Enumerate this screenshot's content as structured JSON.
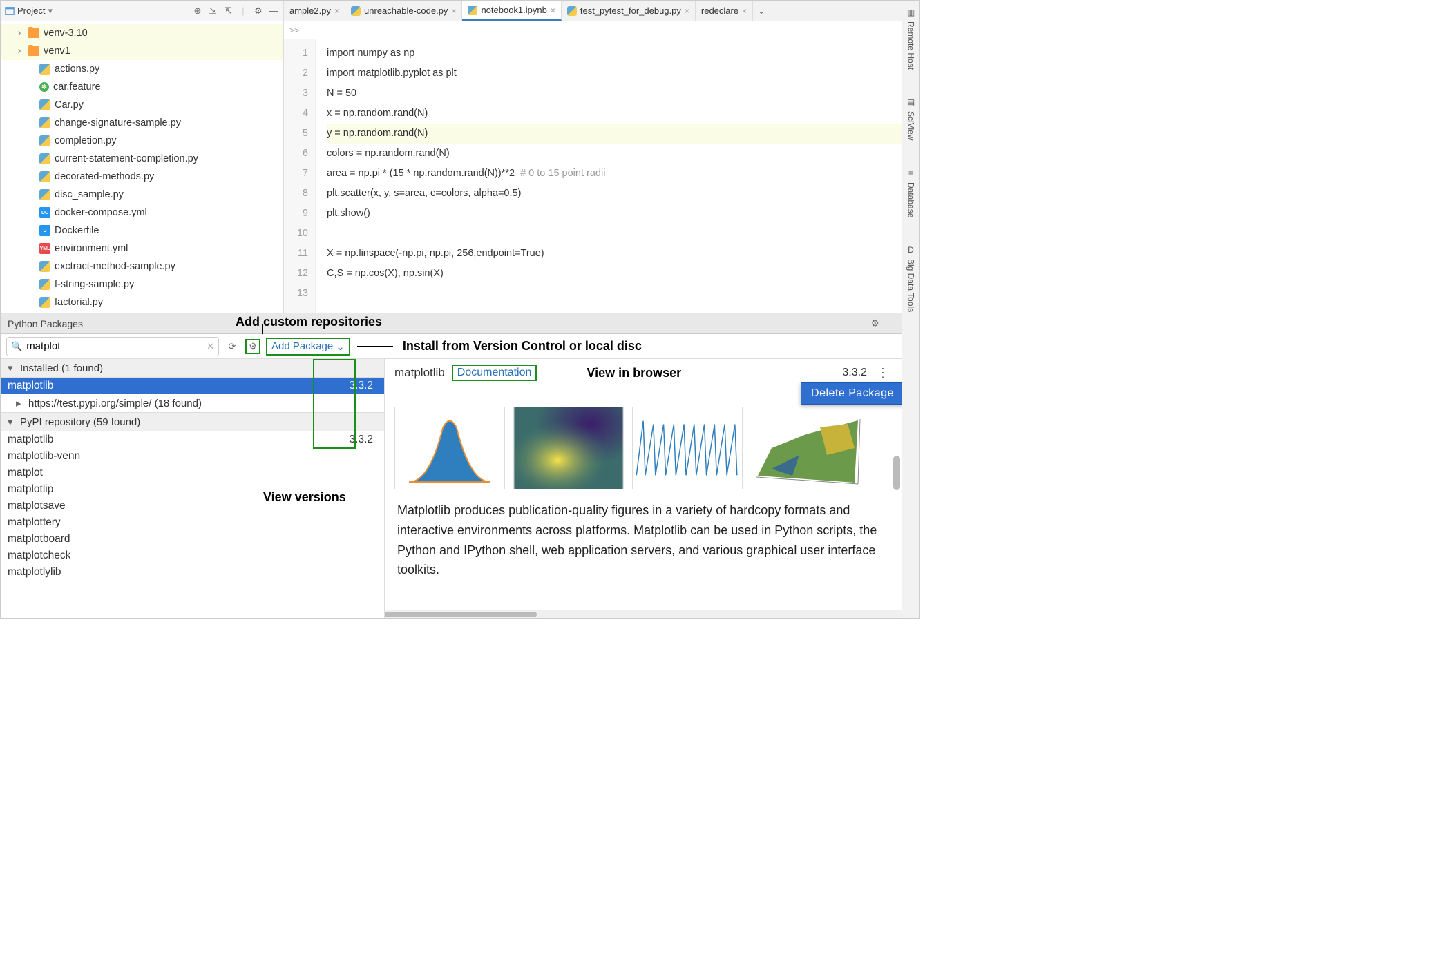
{
  "project": {
    "title": "Project",
    "folders": [
      "venv-3.10",
      "venv1"
    ],
    "files": [
      {
        "name": "actions.py",
        "type": "py"
      },
      {
        "name": "car.feature",
        "type": "feature"
      },
      {
        "name": "Car.py",
        "type": "py"
      },
      {
        "name": "change-signature-sample.py",
        "type": "py"
      },
      {
        "name": "completion.py",
        "type": "py"
      },
      {
        "name": "current-statement-completion.py",
        "type": "py"
      },
      {
        "name": "decorated-methods.py",
        "type": "py"
      },
      {
        "name": "disc_sample.py",
        "type": "py"
      },
      {
        "name": "docker-compose.yml",
        "type": "docker"
      },
      {
        "name": "Dockerfile",
        "type": "dockerfile"
      },
      {
        "name": "environment.yml",
        "type": "yml"
      },
      {
        "name": "exctract-method-sample.py",
        "type": "py"
      },
      {
        "name": "f-string-sample.py",
        "type": "py"
      },
      {
        "name": "factorial.py",
        "type": "py"
      }
    ]
  },
  "tabs": [
    {
      "label": "ample2.py",
      "truncated": true
    },
    {
      "label": "unreachable-code.py"
    },
    {
      "label": "notebook1.ipynb",
      "active": true,
      "type": "ipynb"
    },
    {
      "label": "test_pytest_for_debug.py"
    },
    {
      "label": "redeclare",
      "truncated": true
    }
  ],
  "breadcrumb": ">>",
  "code": {
    "lines": [
      "import numpy as np",
      "import matplotlib.pyplot as plt",
      "N = 50",
      "x = np.random.rand(N)",
      "y = np.random.rand(N)",
      "colors = np.random.rand(N)",
      "area = np.pi * (15 * np.random.rand(N))**2  # 0 to 15 point radii",
      "plt.scatter(x, y, s=area, c=colors, alpha=0.5)",
      "plt.show()",
      "",
      "X = np.linspace(-np.pi, np.pi, 256,endpoint=True)",
      "C,S = np.cos(X), np.sin(X)",
      ""
    ],
    "highlight_line": 5
  },
  "right_tools": [
    "Remote Host",
    "SciView",
    "Database",
    "Big Data Tools"
  ],
  "packages": {
    "title": "Python Packages",
    "search_value": "matplot",
    "add_package_label": "Add Package",
    "groups": [
      {
        "header": "Installed (1 found)",
        "rows": [
          {
            "name": "matplotlib",
            "version": "3.3.2",
            "selected": true
          }
        ],
        "sub": "https://test.pypi.org/simple/ (18 found)"
      },
      {
        "header": "PyPI repository (59 found)",
        "rows": [
          {
            "name": "matplotlib",
            "version": "3.3.2"
          },
          {
            "name": "matplotlib-venn"
          },
          {
            "name": "matplot"
          },
          {
            "name": "matplotlip"
          },
          {
            "name": "matplotsave"
          },
          {
            "name": "matplottery"
          },
          {
            "name": "matplotboard"
          },
          {
            "name": "matplotcheck"
          },
          {
            "name": "matplotlylib"
          }
        ]
      }
    ],
    "detail": {
      "name": "matplotlib",
      "doc_label": "Documentation",
      "version": "3.3.2",
      "delete_label": "Delete Package",
      "description": "Matplotlib produces publication-quality figures in a variety of hardcopy formats and interactive environments across platforms. Matplotlib can be used in Python scripts, the Python and IPython shell, web application servers, and various graphical user interface toolkits."
    }
  },
  "annotations": {
    "add_repos": "Add custom repositories",
    "install_vc": "Install from Version Control or local disc",
    "view_browser": "View in browser",
    "view_versions": "View versions"
  },
  "right_tool_prefix": "D"
}
